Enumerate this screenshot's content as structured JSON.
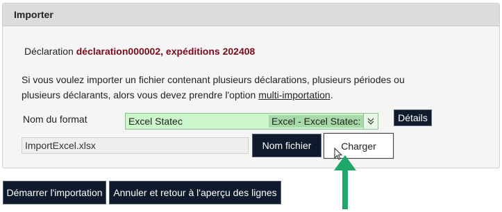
{
  "panel": {
    "title": "Importer"
  },
  "declaration": {
    "label": "Déclaration",
    "value": "déclaration000002, expéditions 202408"
  },
  "info": {
    "text": "Si vous voulez importer un fichier contenant plusieurs déclarations, plusieurs périodes ou plusieurs déclarants, alors vous devez prendre l'option ",
    "link": "multi-importation",
    "suffix": "."
  },
  "format": {
    "label": "Nom du format",
    "selected": "Excel Statec",
    "hint": "Excel - Excel Statec:",
    "details_button": "Détails"
  },
  "file": {
    "value": "ImportExcel.xlsx",
    "browse_button": "Nom fichier",
    "load_button": "Charger"
  },
  "actions": {
    "start": "Démarrer l'importation",
    "cancel": "Annuler et retour à l'aperçu des lignes"
  },
  "colors": {
    "primary_button": "#0f1a2c",
    "declaration_value": "#7a0a1a",
    "select_bg": "#ccf5cc",
    "annotation_arrow": "#1fa86a"
  }
}
